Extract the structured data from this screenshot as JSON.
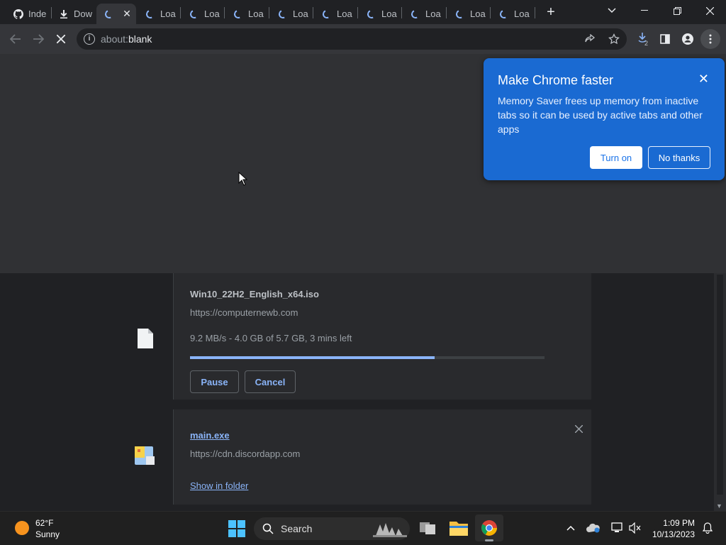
{
  "tabs": [
    {
      "title": "Inde",
      "icon": "github-icon"
    },
    {
      "title": "Dow",
      "icon": "download-icon"
    },
    {
      "title": "",
      "icon": "loading-spinner-icon",
      "active": true
    },
    {
      "title": "Loa",
      "icon": "loading-spinner-icon"
    },
    {
      "title": "Loa",
      "icon": "loading-spinner-icon"
    },
    {
      "title": "Loa",
      "icon": "loading-spinner-icon"
    },
    {
      "title": "Loa",
      "icon": "loading-spinner-icon"
    },
    {
      "title": "Loa",
      "icon": "loading-spinner-icon"
    },
    {
      "title": "Loa",
      "icon": "loading-spinner-icon"
    },
    {
      "title": "Loa",
      "icon": "loading-spinner-icon"
    },
    {
      "title": "Loa",
      "icon": "loading-spinner-icon"
    },
    {
      "title": "Loa",
      "icon": "loading-spinner-icon"
    }
  ],
  "toolbar": {
    "url_prefix": "about:",
    "url_main": "blank",
    "downloads_badge": "2"
  },
  "popup": {
    "title": "Make Chrome faster",
    "body": "Memory Saver frees up memory from inactive tabs so it can be used by active tabs and other apps",
    "turn_on": "Turn on",
    "no_thanks": "No thanks"
  },
  "downloads": [
    {
      "filename": "Win10_22H2_English_x64.iso",
      "url": "https://computernewb.com",
      "status": "9.2 MB/s - 4.0 GB of 5.7 GB, 3 mins left",
      "progress": 0.69,
      "pause": "Pause",
      "cancel": "Cancel"
    },
    {
      "filename": "main.exe",
      "url": "https://cdn.discordapp.com",
      "show_in_folder": "Show in folder"
    }
  ],
  "taskbar": {
    "temperature": "62°F",
    "weather": "Sunny",
    "search": "Search",
    "time": "1:09 PM",
    "date": "10/13/2023"
  },
  "colors": {
    "accent": "#8ab4f8",
    "popup_bg": "#1a6ad2"
  }
}
